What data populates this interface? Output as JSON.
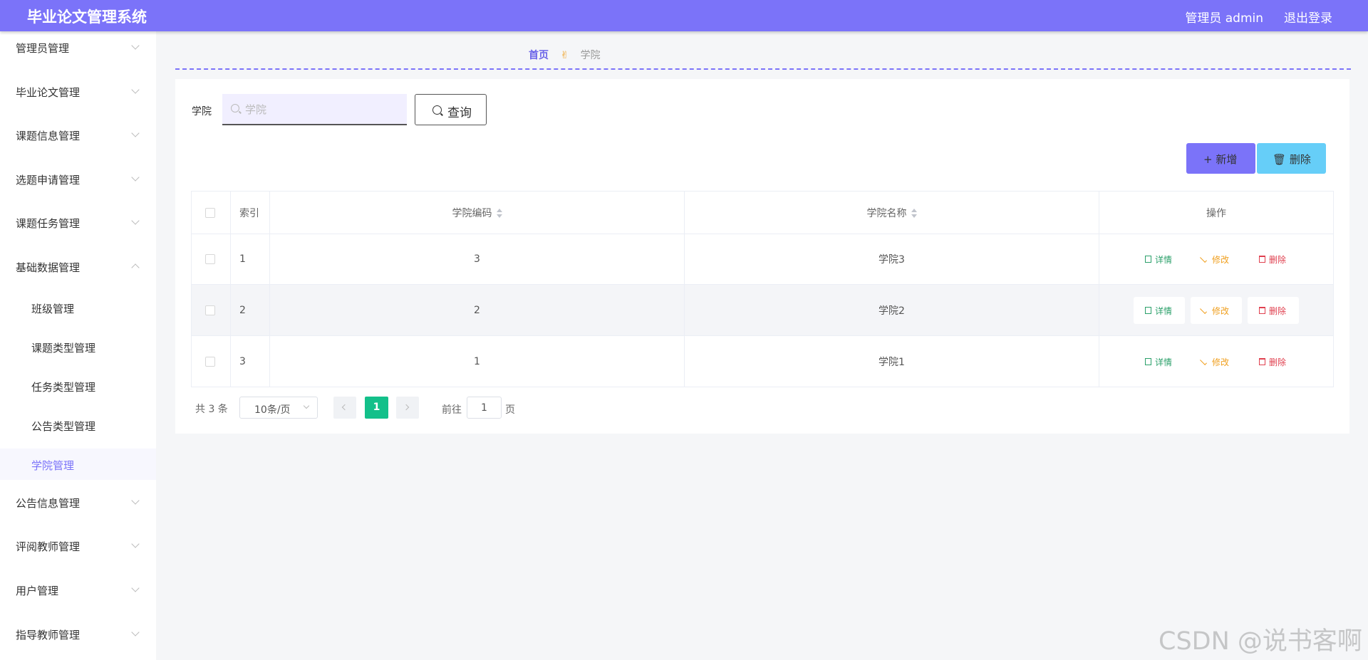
{
  "header": {
    "app_title": "毕业论文管理系统",
    "user_label": "管理员 admin",
    "logout_label": "退出登录"
  },
  "sidebar": {
    "menus": [
      {
        "label": "管理员管理",
        "expanded": false
      },
      {
        "label": "毕业论文管理",
        "expanded": false
      },
      {
        "label": "课题信息管理",
        "expanded": false
      },
      {
        "label": "选题申请管理",
        "expanded": false
      },
      {
        "label": "课题任务管理",
        "expanded": false
      },
      {
        "label": "基础数据管理",
        "expanded": true
      },
      {
        "label": "公告信息管理",
        "expanded": false
      },
      {
        "label": "评阅教师管理",
        "expanded": false
      },
      {
        "label": "用户管理",
        "expanded": false
      },
      {
        "label": "指导教师管理",
        "expanded": false
      }
    ],
    "sub_items": [
      {
        "label": "班级管理",
        "active": false
      },
      {
        "label": "课题类型管理",
        "active": false
      },
      {
        "label": "任务类型管理",
        "active": false
      },
      {
        "label": "公告类型管理",
        "active": false
      },
      {
        "label": "学院管理",
        "active": true
      }
    ]
  },
  "breadcrumb": {
    "home": "首页",
    "separator": "✌",
    "current": "学院"
  },
  "search": {
    "label": "学院",
    "placeholder": "学院",
    "value": "",
    "query_button": "查询"
  },
  "actions": {
    "add_label": "新增",
    "delete_label": "删除"
  },
  "table": {
    "headers": {
      "index": "索引",
      "code": "学院编码",
      "name": "学院名称",
      "ops": "操作"
    },
    "rows": [
      {
        "index": "1",
        "code": "3",
        "name": "学院3"
      },
      {
        "index": "2",
        "code": "2",
        "name": "学院2"
      },
      {
        "index": "3",
        "code": "1",
        "name": "学院1"
      }
    ],
    "op_labels": {
      "detail": "详情",
      "edit": "修改",
      "remove": "删除"
    }
  },
  "pagination": {
    "total": "共 3 条",
    "page_size": "10条/页",
    "current_page": "1",
    "goto_label": "前往",
    "goto_value": "1",
    "page_unit": "页"
  },
  "watermark": "CSDN @说书客啊",
  "colors": {
    "header": "#7b73f9",
    "accent": "#7b73f9",
    "add_button": "#7b73f9",
    "delete_button": "#66cef8",
    "current_page": "#13c08a",
    "detail": "#2ba06a",
    "edit": "#f0a020",
    "remove": "#e0404f"
  }
}
